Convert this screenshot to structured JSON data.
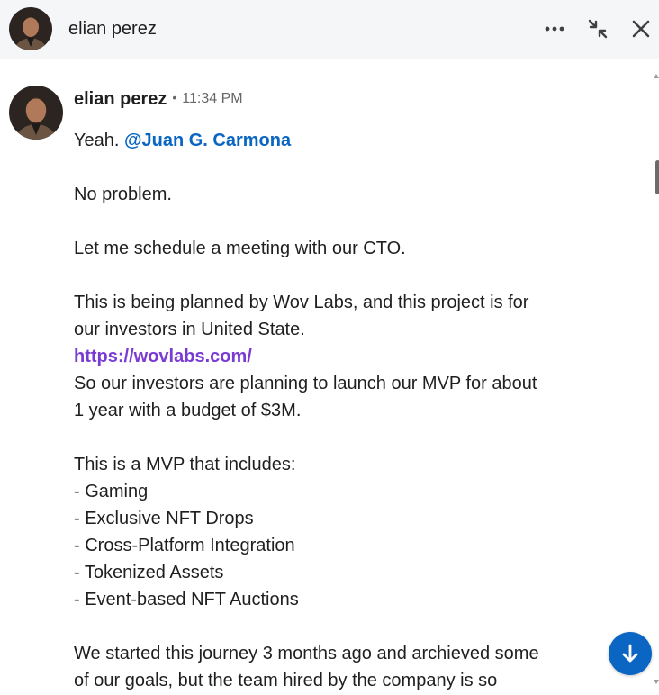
{
  "header": {
    "name": "elian perez",
    "more_icon": "ellipsis-icon",
    "minimize_icon": "collapse-arrows-icon",
    "close_icon": "close-icon"
  },
  "message": {
    "sender": "elian perez",
    "separator": "•",
    "time": "11:34 PM",
    "greeting": "Yeah.",
    "mention": "@Juan G. Carmona",
    "p_no_problem": "No problem.",
    "p_schedule": "Let me schedule a meeting with our CTO.",
    "p_planned_1": "This is being planned by Wov Labs, and this project is for",
    "p_planned_2": "our investors in United State.",
    "link": "https://wovlabs.com/",
    "p_investors_1": "So our investors are planning to launch our MVP for about",
    "p_investors_2": "1 year with a budget of $3M.",
    "p_mvp_intro": "This is a MVP that includes:",
    "mvp_items": [
      "- Gaming",
      "- Exclusive NFT Drops",
      "- Cross-Platform Integration",
      "- Tokenized Assets",
      "- Event-based NFT Auctions"
    ],
    "p_journey_1": "We started this journey 3 months ago and archieved some",
    "p_journey_2": "of our goals, but the team hired by the company is so"
  },
  "jump_button_icon": "arrow-down-icon",
  "colors": {
    "mention": "#0a66c2",
    "link": "#7a3bd4",
    "header_bg": "#f5f6f8",
    "jump_button": "#0a66c2"
  }
}
